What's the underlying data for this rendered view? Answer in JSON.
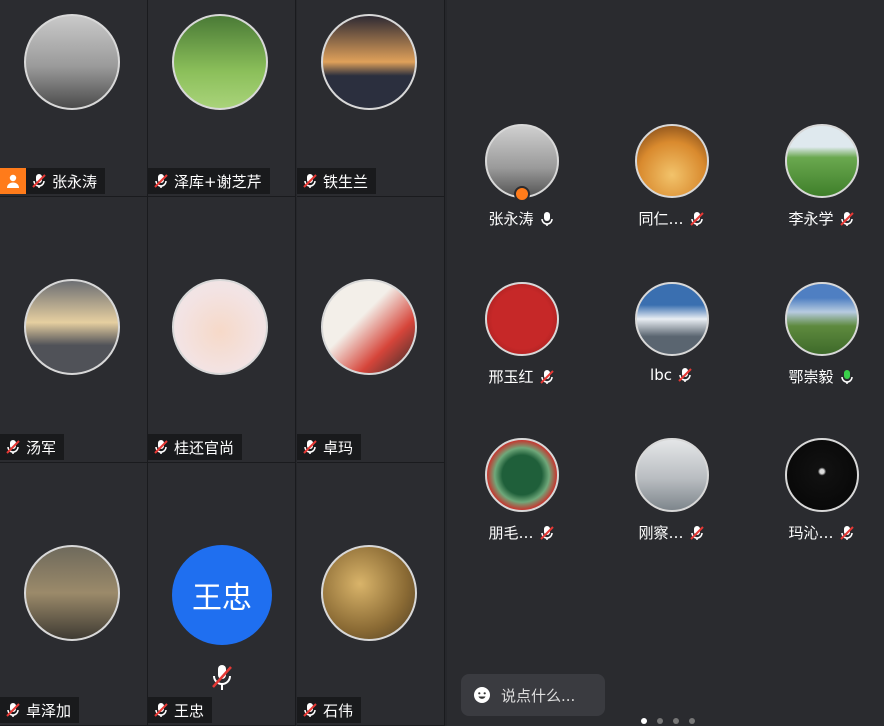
{
  "grid": [
    {
      "name": "张永涛",
      "host": true,
      "mic": "muted"
    },
    {
      "name": "泽库+谢芝芹",
      "host": false,
      "mic": "muted"
    },
    {
      "name": "铁生兰",
      "host": false,
      "mic": "muted"
    },
    {
      "name": "汤军",
      "host": false,
      "mic": "muted"
    },
    {
      "name": "桂还官尚",
      "host": false,
      "mic": "muted"
    },
    {
      "name": "卓玛",
      "host": false,
      "mic": "muted"
    },
    {
      "name": "卓泽加",
      "host": false,
      "mic": "muted"
    },
    {
      "name": "王忠",
      "host": false,
      "mic": "muted",
      "initials": "王忠"
    },
    {
      "name": "石伟",
      "host": false,
      "mic": "muted"
    }
  ],
  "participants": [
    {
      "name": "张永涛",
      "mic": "on",
      "host": true
    },
    {
      "name": "同仁…",
      "mic": "muted"
    },
    {
      "name": "李永学",
      "mic": "muted"
    },
    {
      "name": "邢玉红",
      "mic": "muted"
    },
    {
      "name": "lbc",
      "mic": "muted"
    },
    {
      "name": "鄂崇毅",
      "mic": "speaking"
    },
    {
      "name": "朋毛…",
      "mic": "muted"
    },
    {
      "name": "刚察…",
      "mic": "muted"
    },
    {
      "name": "玛沁…",
      "mic": "muted"
    }
  ],
  "chat": {
    "placeholder": "说点什么..."
  },
  "pager": {
    "pages": 4,
    "current": 1
  },
  "colors": {
    "host": "#ff7b1a",
    "muted": "#e53935",
    "speaking": "#3ad14a",
    "initials_bg": "#1f6ff0"
  }
}
